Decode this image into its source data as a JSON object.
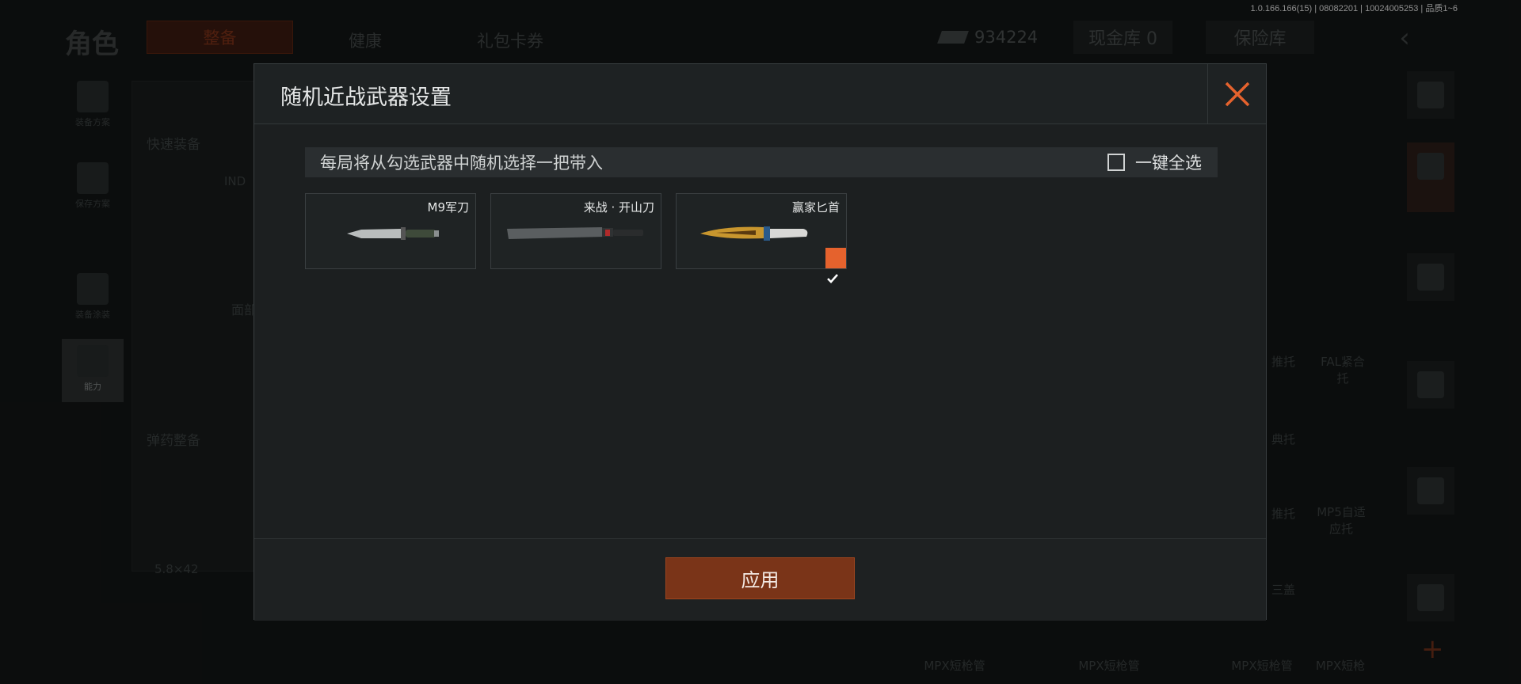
{
  "version_info": "1.0.166.166(15) | 08082201 | 10024005253 | 品质1~6",
  "background": {
    "page_title": "角色",
    "tabs": [
      "整备",
      "健康",
      "礼包卡券"
    ],
    "currency_amount": "934224",
    "cash_vault_label": "现金库 0",
    "insurance_label": "保险库",
    "left_sidebar": [
      {
        "label": "装备方案"
      },
      {
        "label": "保存方案"
      },
      {
        "label": "装备涂装"
      },
      {
        "label": "能力"
      }
    ],
    "quick_equip": "快速装备",
    "ammo_equip": "弹药整备",
    "ammo_caliber": "5.8×42",
    "slot_label_face": "面部",
    "slot_label_ind": "IND",
    "right_cells": [
      "FAL紧合托",
      "MP5自适应托",
      "MPX短枪管",
      "MPX短枪管",
      "MPX短枪管",
      "MPX短枪"
    ],
    "stock_labels": [
      "推托",
      "典托",
      "推托",
      "三盖"
    ]
  },
  "modal": {
    "title": "随机近战武器设置",
    "info_text": "每局将从勾选武器中随机选择一把带入",
    "select_all_label": "一键全选",
    "select_all_checked": false,
    "weapons": [
      {
        "name": "M9军刀",
        "checked": false
      },
      {
        "name": "来战 · 开山刀",
        "checked": false
      },
      {
        "name": "赢家匕首",
        "checked": true
      }
    ],
    "apply_label": "应用"
  },
  "colors": {
    "accent": "#e5622d",
    "apply_button": "#7a3418",
    "close_icon": "#e5622d"
  }
}
